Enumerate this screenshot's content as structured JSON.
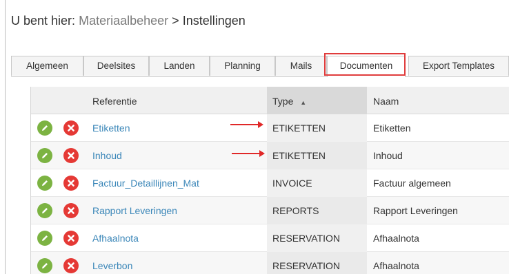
{
  "breadcrumb": {
    "prefix": "U bent hier:",
    "link": "Materiaalbeheer",
    "separator": ">",
    "current": "Instellingen"
  },
  "tabs": [
    {
      "label": "Algemeen",
      "active": false
    },
    {
      "label": "Deelsites",
      "active": false
    },
    {
      "label": "Landen",
      "active": false
    },
    {
      "label": "Planning",
      "active": false
    },
    {
      "label": "Mails",
      "active": false
    },
    {
      "label": "Documenten",
      "active": true
    },
    {
      "label": "Export Templates",
      "active": false
    }
  ],
  "table": {
    "headers": {
      "referentie": "Referentie",
      "type": "Type",
      "sort_indicator": "▲",
      "naam": "Naam"
    },
    "rows": [
      {
        "referentie": "Etiketten",
        "type": "ETIKETTEN",
        "naam": "Etiketten"
      },
      {
        "referentie": "Inhoud",
        "type": "ETIKETTEN",
        "naam": "Inhoud"
      },
      {
        "referentie": "Factuur_Detaillijnen_Mat",
        "type": "INVOICE",
        "naam": "Factuur algemeen"
      },
      {
        "referentie": "Rapport Leveringen",
        "type": "REPORTS",
        "naam": "Rapport Leveringen"
      },
      {
        "referentie": "Afhaalnota",
        "type": "RESERVATION",
        "naam": "Afhaalnota"
      },
      {
        "referentie": "Leverbon",
        "type": "RESERVATION",
        "naam": "Afhaalnota"
      }
    ]
  },
  "icons": {
    "edit": "pencil-icon",
    "delete": "close-icon"
  },
  "colors": {
    "edit_button": "#7cb342",
    "delete_button": "#e53935",
    "link": "#3a86b8",
    "annotation": "#e02828"
  }
}
